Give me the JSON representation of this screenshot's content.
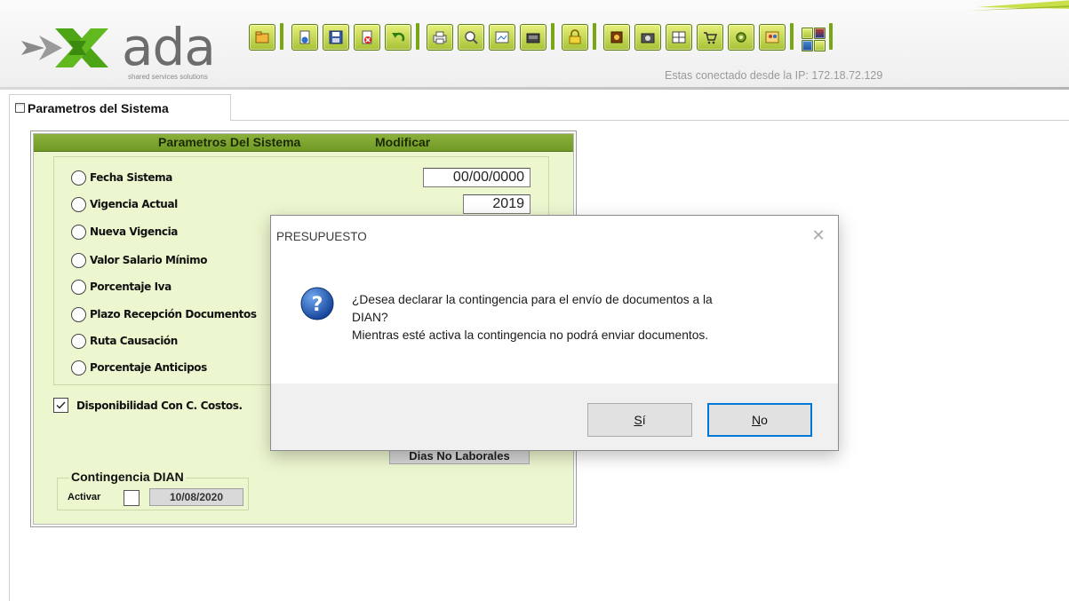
{
  "app": {
    "logo_text": "ada",
    "logo_tagline": "shared services solutions",
    "ip_status": "Estas conectado desde la IP: 172.18.72.129"
  },
  "tabs": [
    {
      "label": "Parametros del Sistema"
    }
  ],
  "panel": {
    "title": "Parametros Del Sistema",
    "mode": "Modificar",
    "params": [
      {
        "label": "Fecha Sistema",
        "value": "00/00/0000"
      },
      {
        "label": "Vigencia Actual",
        "value": "2019"
      },
      {
        "label": "Nueva Vigencia"
      },
      {
        "label": "Valor Salario Mínimo"
      },
      {
        "label": "Porcentaje Iva"
      },
      {
        "label": "Plazo Recepción Documentos"
      },
      {
        "label": "Ruta Causación"
      },
      {
        "label": "Porcentaje Anticipos"
      }
    ],
    "disponibilidad": {
      "label": "Disponibilidad Con C. Costos.",
      "checked": true
    },
    "dias_button": "Dias No Laborales",
    "contingencia": {
      "title": "Contingencia DIAN",
      "activar_label": "Activar",
      "activar_checked": false,
      "date": "10/08/2020"
    }
  },
  "dialog": {
    "title": "PRESUPUESTO",
    "close_glyph": "✕",
    "message_line1": "¿Desea declarar la contingencia para el envío de documentos a la",
    "message_line2": "DIAN?",
    "message_line3": "Mientras esté activa la contingencia no podrá enviar documentos.",
    "yes_label": "í",
    "yes_mnemonic": "S",
    "no_label": "o",
    "no_mnemonic": "N"
  },
  "colors": {
    "panel_bg": "#ecf6cf",
    "panel_header": "#7ea42f",
    "toolbar_green": "#b5cc3e",
    "dialog_primary_border": "#0078d7"
  },
  "icons": {
    "toolbar": [
      "open-icon",
      "separator",
      "new-icon",
      "save-icon",
      "delete-icon",
      "undo-icon",
      "separator",
      "print-icon",
      "search-icon",
      "preview-icon",
      "export-icon",
      "separator",
      "lock-icon",
      "separator",
      "money-icon",
      "camera-icon",
      "grid-icon",
      "cart-icon",
      "settings-icon",
      "users-icon",
      "separator",
      "mini-icons"
    ],
    "dialog": "question-icon",
    "tab": "window-icon"
  }
}
